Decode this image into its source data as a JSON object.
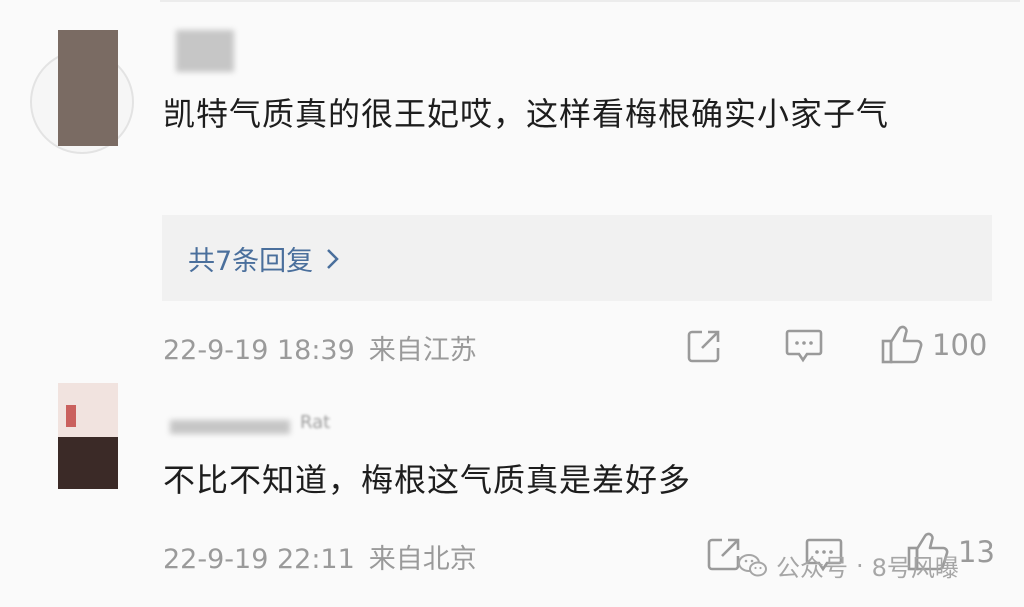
{
  "comments": [
    {
      "username": "",
      "text": "凯特气质真的很王妃哎，这样看梅根确实小家子气",
      "replies_label": "共7条回复",
      "date": "22-9-19 18:39",
      "location": "来自江苏",
      "likes": "100"
    },
    {
      "username": "Rat",
      "text": "不比不知道，梅根这气质真是差好多",
      "date": "22-9-19 22:11",
      "location": "来自北京",
      "likes": "13"
    }
  ],
  "watermark": {
    "prefix": "公众号",
    "separator": "·",
    "name": "8号风曝"
  },
  "icons": {
    "share": "share-icon",
    "comment": "comment-icon",
    "like": "thumbs-up-icon",
    "chevron": "chevron-right-icon",
    "wechat": "wechat-icon"
  },
  "colors": {
    "link": "#4a6f9c",
    "meta": "#9a9a9a",
    "reply_bg": "#f1f1f1"
  }
}
